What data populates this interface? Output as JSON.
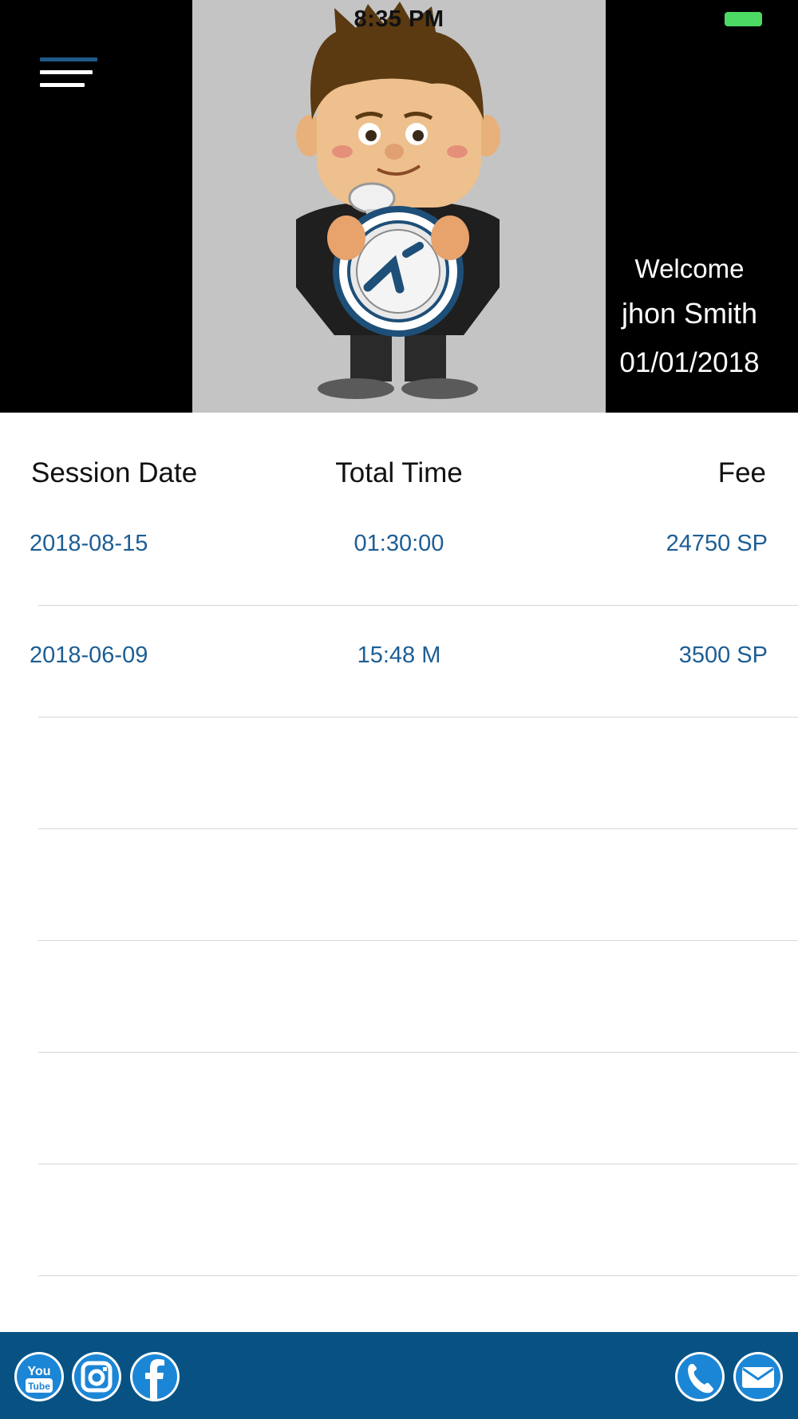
{
  "status_bar": {
    "time": "8:35 PM"
  },
  "welcome": {
    "greeting": "Welcome",
    "name": "jhon Smith",
    "date": "01/01/2018"
  },
  "table": {
    "headers": {
      "date": "Session Date",
      "time": "Total Time",
      "fee": "Fee"
    },
    "rows": [
      {
        "date": "2018-08-15",
        "time": "01:30:00",
        "fee": "24750 SP"
      },
      {
        "date": "2018-06-09",
        "time": "15:48 M",
        "fee": "3500 SP"
      },
      {
        "date": "",
        "time": "",
        "fee": ""
      },
      {
        "date": "",
        "time": "",
        "fee": ""
      },
      {
        "date": "",
        "time": "",
        "fee": ""
      },
      {
        "date": "",
        "time": "",
        "fee": ""
      },
      {
        "date": "",
        "time": "",
        "fee": ""
      }
    ]
  },
  "footer": {
    "icons": [
      "youtube-icon",
      "instagram-icon",
      "facebook-icon",
      "phone-icon",
      "mail-icon"
    ],
    "youtube_label_top": "You",
    "youtube_label_bottom": "Tube"
  },
  "colors": {
    "accent": "#1d5e94",
    "footer_bg": "#075283",
    "battery": "#4cd964"
  }
}
